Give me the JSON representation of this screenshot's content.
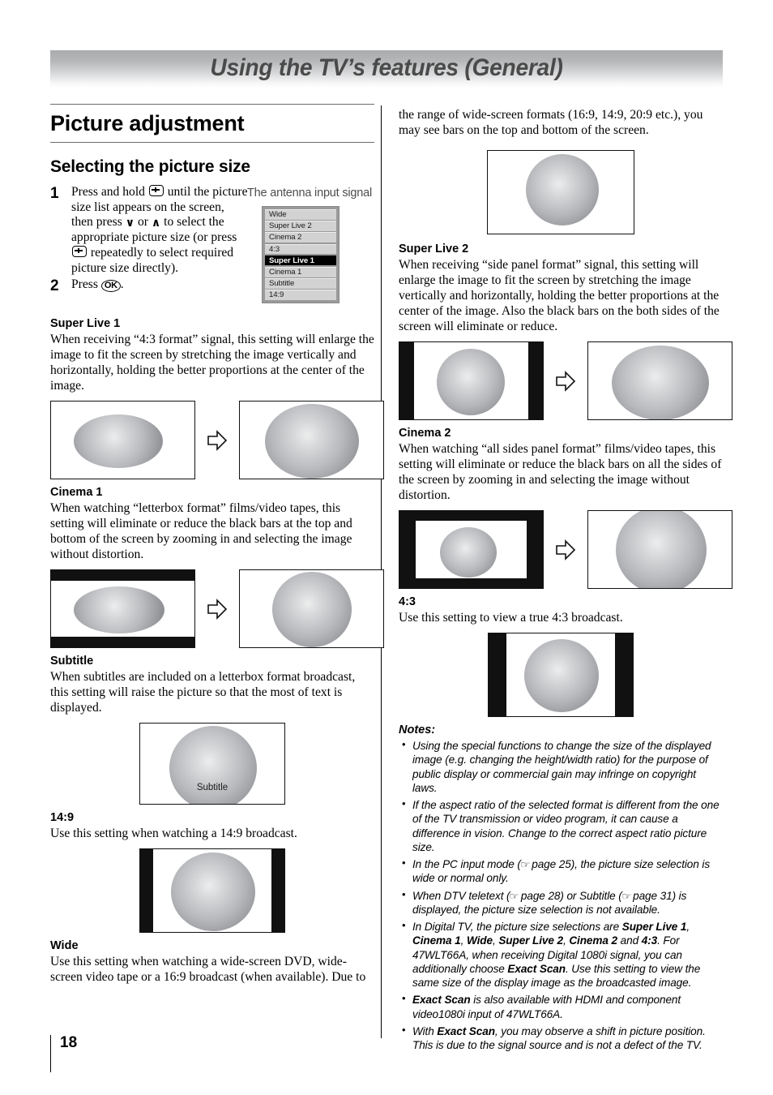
{
  "header": {
    "title": "Using the TV’s features (General)"
  },
  "left_column": {
    "section_title": "Picture adjustment",
    "subsection_title": "Selecting the picture size",
    "steps": [
      {
        "num": "1",
        "text_a": "Press and hold ",
        "text_b": " until the picture size list appears on the screen, then press ",
        "text_c": " or ",
        "text_d": " to select the appropriate picture size (or press ",
        "text_e": " repeatedly to select required picture size directly).",
        "chev_down": "∨",
        "chev_up": "∧"
      },
      {
        "num": "2",
        "text_a": "Press ",
        "ok_label": "OK",
        "text_b": "."
      }
    ],
    "osd": {
      "caption": "The antenna input signal",
      "items": [
        {
          "label": "Wide",
          "selected": false
        },
        {
          "label": "Super Live 2",
          "selected": false
        },
        {
          "label": "Cinema 2",
          "selected": false
        },
        {
          "label": "4:3",
          "selected": false
        },
        {
          "label": "Super Live 1",
          "selected": true
        },
        {
          "label": "Cinema 1",
          "selected": false
        },
        {
          "label": "Subtitle",
          "selected": false
        },
        {
          "label": "14:9",
          "selected": false
        }
      ]
    },
    "sections": [
      {
        "heading": "Super Live 1",
        "body": "When receiving “4:3 format” signal, this setting will enlarge the image to fit the screen by stretching the image vertically and horizontally, holding the better proportions at the center of the image."
      },
      {
        "heading": "Cinema 1",
        "body": "When watching “letterbox format” films/video tapes, this setting will eliminate or reduce the black bars at the top and bottom of the screen by zooming in and selecting the image without distortion."
      },
      {
        "heading": "Subtitle",
        "body": "When subtitles are included on a letterbox format broadcast, this setting will raise the picture so that the most of text is displayed.",
        "figure_label": "Subtitle"
      },
      {
        "heading": "14:9",
        "body": "Use this setting when watching a 14:9 broadcast."
      },
      {
        "heading": "Wide",
        "body": "Use this setting when watching a wide-screen DVD, wide-screen video tape or a 16:9 broadcast (when available). Due to"
      }
    ]
  },
  "right_column": {
    "intro": "the range of wide-screen formats (16:9, 14:9, 20:9 etc.), you may see bars on the top and bottom of the screen.",
    "sections": [
      {
        "heading": "Super Live 2",
        "body": "When receiving “side panel format” signal, this setting will enlarge the image to fit the screen by stretching the image vertically and horizontally, holding the better proportions at the center of the image. Also the black bars on the both sides of the screen will eliminate or reduce."
      },
      {
        "heading": "Cinema 2",
        "body": "When watching “all sides panel format” films/video tapes, this setting will eliminate or reduce the black bars on all the sides of the screen by zooming in and selecting the image without distortion."
      },
      {
        "heading": "4:3",
        "body": "Use this setting to view a true 4:3 broadcast."
      }
    ],
    "notes": {
      "title": "Notes:",
      "items": [
        "Using the special functions to change the size of the displayed image (e.g. changing the height/width ratio) for the purpose of public display or commercial gain may infringe on copyright laws.",
        "If the aspect ratio of the selected format is different from the one of the TV transmission or video program, it can cause a difference in vision. Change to the correct aspect ratio picture size.",
        "In the PC input mode (☞ page 25), the picture size selection is wide or normal only.",
        "When DTV teletext (☞ page 28) or  Subtitle (☞ page 31) is displayed, the picture size selection is not available.",
        "In Digital TV, the picture size selections are Super Live 1, Cinema 1, Wide, Super Live 2, Cinema 2 and 4:3. For 47WLT66A, when receiving Digital 1080i signal, you can additionally choose Exact Scan. Use this setting to view the same size of the display image as the broadcasted image.",
        "Exact Scan is also available with HDMI and component video1080i input of 47WLT66A.",
        "With Exact Scan, you may observe a shift in picture position. This is due to the signal source and is not a defect of the TV."
      ]
    }
  },
  "footer": {
    "page_number": "18"
  }
}
